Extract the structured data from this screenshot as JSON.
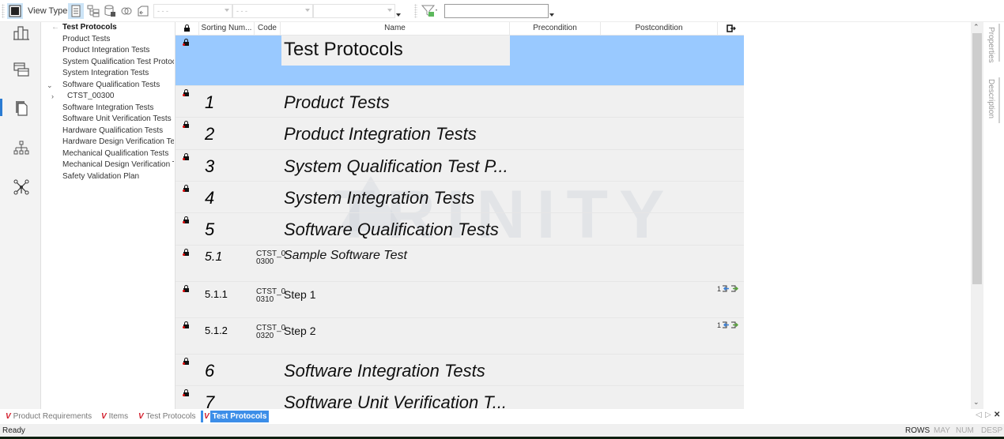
{
  "toolbar": {
    "view_type_label": "View Type",
    "combo1_value": "- - -",
    "combo2_value": "- - -",
    "combo3_value": "",
    "filter_value": ""
  },
  "rail": {
    "items": [
      {
        "icon": "bar-chart-icon",
        "active": false
      },
      {
        "icon": "windows-icon",
        "active": false
      },
      {
        "icon": "documents-icon",
        "active": true
      },
      {
        "icon": "hierarchy-icon",
        "active": false
      },
      {
        "icon": "network-icon",
        "active": false
      }
    ]
  },
  "tree": {
    "root": "Test Protocols",
    "items": [
      {
        "label": "Product Tests",
        "expander": ""
      },
      {
        "label": "Product Integration Tests",
        "expander": ""
      },
      {
        "label": "System Qualification Test Protocols",
        "expander": ""
      },
      {
        "label": "System Integration Tests",
        "expander": ""
      },
      {
        "label": "Software Qualification Tests",
        "expander": "expanded"
      },
      {
        "label": "CTST_00300",
        "expander": "collapsed"
      },
      {
        "label": "Software Integration Tests",
        "expander": ""
      },
      {
        "label": "Software Unit Verification Tests",
        "expander": ""
      },
      {
        "label": "Hardware Qualification Tests",
        "expander": ""
      },
      {
        "label": "Hardware Design Verification Tests",
        "expander": ""
      },
      {
        "label": "Mechanical Qualification Tests",
        "expander": ""
      },
      {
        "label": "Mechanical Design Verification Tests",
        "expander": ""
      },
      {
        "label": "Safety Validation Plan",
        "expander": ""
      }
    ]
  },
  "grid": {
    "columns": {
      "lock": "",
      "sorting_number": "Sorting Num...",
      "code": "Code",
      "name": "Name",
      "precondition": "Precondition",
      "postcondition": "Postcondition"
    },
    "title_row": {
      "name": "Test Protocols"
    },
    "rows": [
      {
        "sort": "1",
        "code1": "",
        "code2": "",
        "name": "Product Tests",
        "level": 1,
        "links": ""
      },
      {
        "sort": "2",
        "code1": "",
        "code2": "",
        "name": "Product Integration Tests",
        "level": 1,
        "links": ""
      },
      {
        "sort": "3",
        "code1": "",
        "code2": "",
        "name": "System Qualification Test P...",
        "level": 1,
        "links": ""
      },
      {
        "sort": "4",
        "code1": "",
        "code2": "",
        "name": "System Integration Tests",
        "level": 1,
        "links": ""
      },
      {
        "sort": "5",
        "code1": "",
        "code2": "",
        "name": "Software Qualification Tests",
        "level": 1,
        "links": ""
      },
      {
        "sort": "5.1",
        "code1": "CTST_0",
        "code2": "0300",
        "name": "Sample Software Test",
        "level": 2,
        "links": ""
      },
      {
        "sort": "5.1.1",
        "code1": "CTST_0",
        "code2": "0310",
        "name": "Step 1",
        "level": 3,
        "links": "1"
      },
      {
        "sort": "5.1.2",
        "code1": "CTST_0",
        "code2": "0320",
        "name": "Step 2",
        "level": 3,
        "links": "1"
      },
      {
        "sort": "6",
        "code1": "",
        "code2": "",
        "name": "Software Integration Tests",
        "level": 1,
        "links": ""
      },
      {
        "sort": "7",
        "code1": "",
        "code2": "",
        "name": "Software Unit Verification T...",
        "level": 1,
        "links": ""
      }
    ],
    "watermark": "TRINITY"
  },
  "side_panel": {
    "tabs": [
      "Properties",
      "Description"
    ]
  },
  "doc_tabs": [
    {
      "label": "Product Requirements",
      "active": false
    },
    {
      "label": "Items",
      "active": false
    },
    {
      "label": "Test Protocols",
      "active": false
    },
    {
      "label": "Test Protocols",
      "active": true
    }
  ],
  "status": {
    "text": "Ready",
    "indicators": [
      {
        "label": "ROWS",
        "on": true
      },
      {
        "label": "MAY",
        "on": false
      },
      {
        "label": "NUM",
        "on": false
      },
      {
        "label": "DESP",
        "on": false
      }
    ]
  }
}
